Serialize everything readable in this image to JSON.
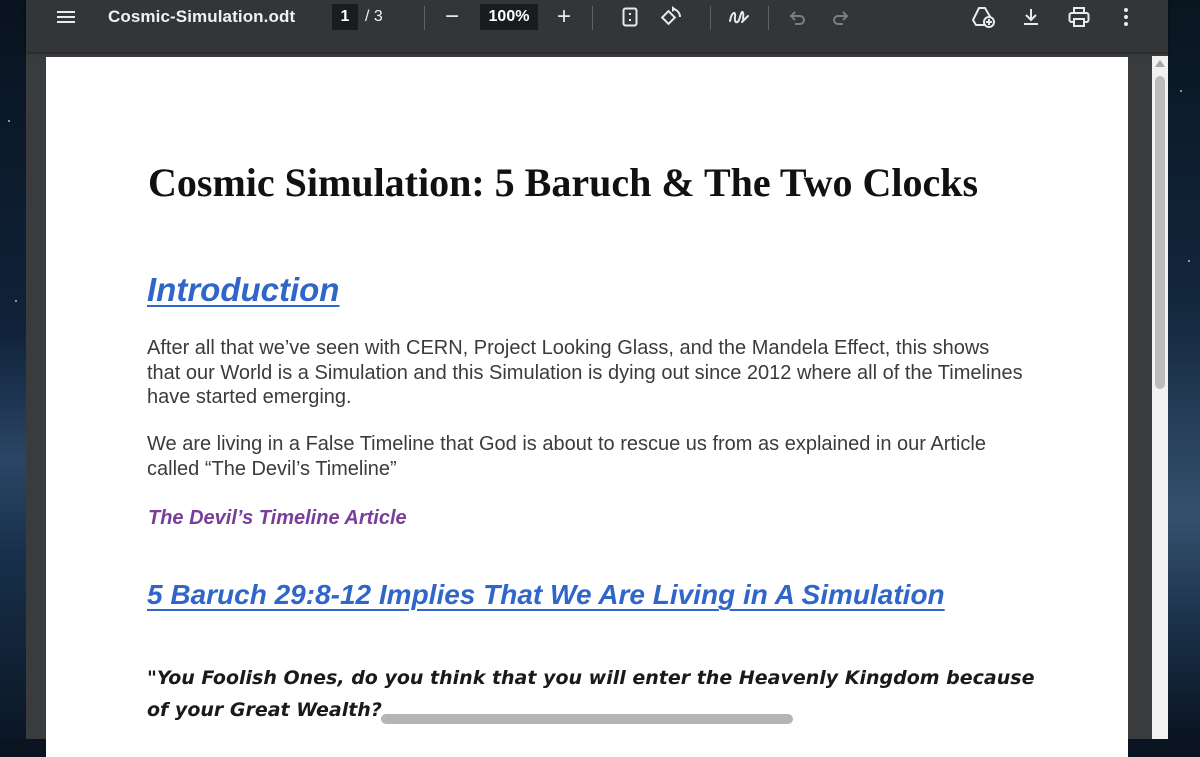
{
  "toolbar": {
    "filename": "Cosmic-Simulation.odt",
    "current_page": "1",
    "page_separator": "/",
    "total_pages": "3",
    "zoom": "100%",
    "zoom_out_symbol": "−",
    "zoom_in_symbol": "+",
    "icons": [
      "menu-icon",
      "zoom-out-icon",
      "zoom-in-icon",
      "fit-page-icon",
      "rotate-icon",
      "annotate-icon",
      "undo-icon",
      "redo-icon",
      "add-to-drive-icon",
      "download-icon",
      "print-icon",
      "more-options-icon"
    ]
  },
  "document": {
    "title": "Cosmic Simulation: 5 Baruch & The Two Clocks",
    "intro_heading": "Introduction",
    "paragraph1": "After all that we’ve seen with CERN, Project Looking Glass, and the Mandela Effect, this shows that our World is a Simulation and this Simulation is dying out since 2012 where all of the Timelines have started emerging.",
    "paragraph2": "We are living in a False Timeline that God is about to rescue us from as explained in our Article called “The Devil’s Timeline”",
    "article_link": "The Devil’s Timeline Article",
    "section_heading": "5 Baruch 29:8-12 Implies That We Are Living in A Simulation",
    "quote": "\"You Foolish Ones, do you think that you will enter the Heavenly Kingdom because of your Great Wealth?"
  },
  "colors": {
    "toolbar_bg": "#323639",
    "viewer_bg": "#3a3b3d",
    "link_blue": "#2f66c8",
    "link_purple": "#7a3e99"
  }
}
